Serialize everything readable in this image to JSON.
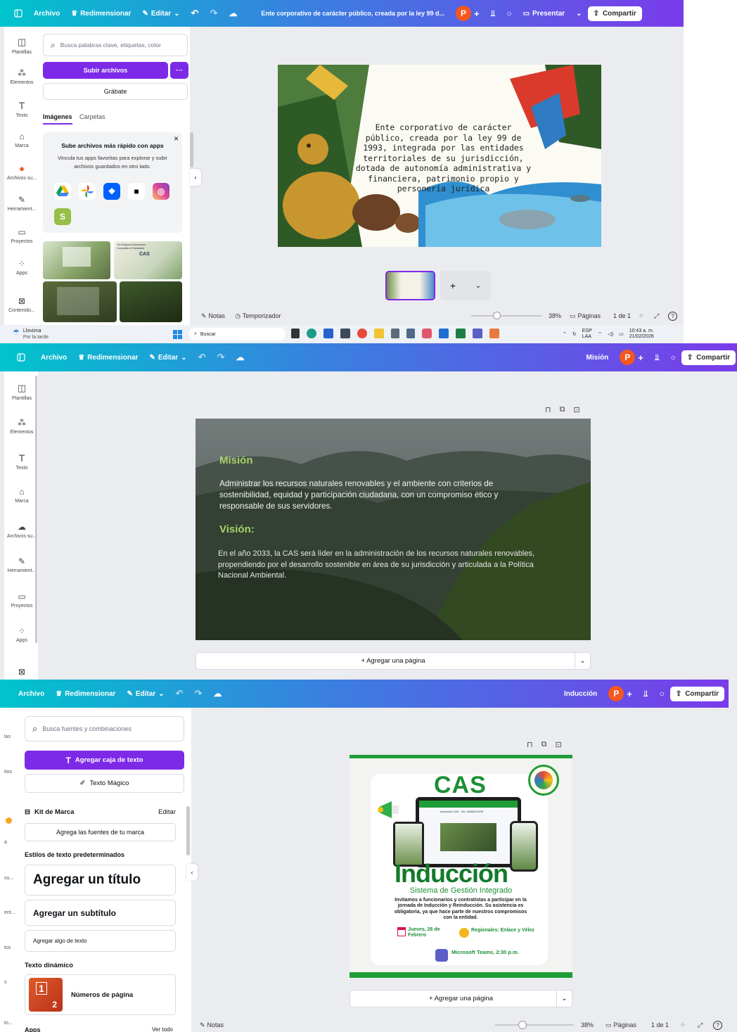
{
  "shot1": {
    "topbar": {
      "file": "Archivo",
      "resize": "Redimensionar",
      "edit": "Editar",
      "doc_title": "Ente corporativo de carácter público, creada por la ley 99 d...",
      "avatar": "P",
      "present": "Presentar",
      "share": "Compartir"
    },
    "rail": [
      "Plantillas",
      "Elementos",
      "Texto",
      "Marca",
      "Archivos su...",
      "Herramient...",
      "Proyectos",
      "Apps",
      "Contenido..."
    ],
    "panel": {
      "search_placeholder": "Busca palabras clave, etiquetas, color",
      "upload": "Subir archivos",
      "more": "···",
      "record": "Grábate",
      "tab_images": "Imágenes",
      "tab_folders": "Carpetas",
      "promo_title": "Sube archivos más rápido con apps",
      "promo_body": "Vincula tus apps favoritas para explorar y subir archivos guardados en otro lado.",
      "promo_close": "×",
      "thumb_title_1": "The Regional Autonomous Corporation of Santander",
      "thumb_cas": "CAS"
    },
    "slide_text": "Ente corporativo de carácter público, creada por la ley 99 de 1993, integrada por las entidades territoriales de su jurisdicción, dotada de autonomía administrativa y financiera, patrimonio propio y personería jurídica",
    "filmstrip": {
      "add": "+",
      "chevron": "⌄"
    },
    "footer": {
      "notes": "Notas",
      "timer": "Temporizador",
      "zoom": "38%",
      "pages": "Páginas",
      "page_count": "1 de 1",
      "help": "?"
    },
    "taskbar": {
      "weather_title": "Lloviznа",
      "weather_sub": "Por la tarde",
      "search": "Buscar",
      "lang1": "ESP",
      "lang2": "LAA",
      "time": "10:43 a. m.",
      "date": "21/02/2026"
    }
  },
  "shot2": {
    "topbar": {
      "file": "Archivo",
      "resize": "Redimensionar",
      "edit": "Editar",
      "doc_title": "Misión",
      "avatar": "P",
      "share": "Compartir"
    },
    "rail": [
      "Plantillas",
      "Elementos",
      "Texto",
      "Marca",
      "Archivos su...",
      "Herramient...",
      "Proyectos",
      "Apps"
    ],
    "slide": {
      "mision_title": "Misión",
      "mision_body": "Administrar los recursos naturales renovables y el ambiente con criterios de sostenibilidad, equidad y participación ciudadana, con un compromiso ético y responsable de sus servidores.",
      "vision_title": "Visión:",
      "vision_body": "En el año 2033, la CAS será líder en la administración de los recursos naturales renovables, propendiendo por el desarrollo sostenible en área de su jurisdicción y articulada a la Política Nacional Ambiental."
    },
    "add_page": "+ Agregar una página"
  },
  "shot3": {
    "topbar": {
      "file": "Archivo",
      "resize": "Redimensionar",
      "edit": "Editar",
      "doc_title": "Inducción",
      "avatar": "P",
      "share": "Compartir"
    },
    "rail_fragments": [
      "las",
      "itos",
      "a",
      "su...",
      "ent...",
      "tos",
      "s",
      "to..."
    ],
    "panel": {
      "search_placeholder": "Busca fuentes y combinaciones",
      "add_textbox": "Agregar caja de texto",
      "magic_text": "Texto Mágico",
      "brand_kit": "Kit de Marca",
      "brand_edit": "Editar",
      "brand_fonts": "Agrega las fuentes de tu marca",
      "default_styles": "Estilos de texto predeterminados",
      "add_title": "Agregar un título",
      "add_subtitle": "Agregar un subtítulo",
      "add_body": "Agregar algo de texto",
      "dynamic_text": "Texto dinámico",
      "page_numbers": "Números de página",
      "pn_1": "1",
      "pn_2": "2",
      "apps": "Apps",
      "see_all": "Ver todo"
    },
    "slide": {
      "brand": "CAS",
      "headline": "Inducción",
      "subtitle": "Sistema de Gestión Integrado",
      "body": "Invitamos a funcionarios y contratistas a participar en la jornada de Inducción y Reinducción. Su asistencia es obligatoria, ya que hace parte de nuestros compromisos con la entidad.",
      "date": "Jueves, 26 de Febrero",
      "regional": "Regionales: Enlace y Vélez",
      "platform": "Microsoft Teams, 2:30 p.m.",
      "screen_text": "Inducción CAS · No. 000083-2025"
    },
    "add_page": "+ Agregar una página",
    "footer": {
      "notes": "Notas",
      "zoom": "38%",
      "pages": "Páginas",
      "page_count": "1 de 1",
      "help": "?"
    }
  }
}
